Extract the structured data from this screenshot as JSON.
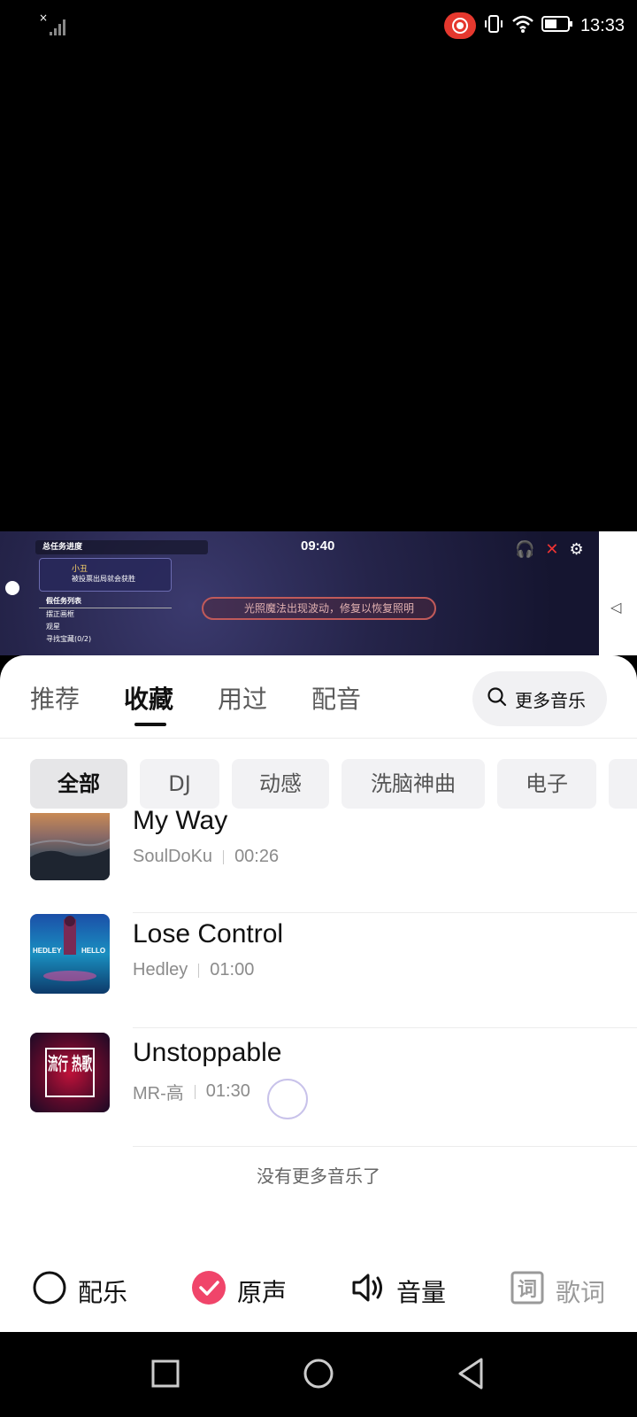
{
  "status_bar": {
    "time": "13:33"
  },
  "game": {
    "time": "09:40",
    "task_title": "总任务进度",
    "card_name": "小丑",
    "card_desc": "被投票出局就会获胜",
    "list_header": "假任务列表",
    "list_items": [
      "摆正画框",
      "观星",
      "寻找宝藏(0/2)"
    ],
    "banner": "光照魔法出现波动，修复以恢复照明"
  },
  "tabs": [
    {
      "label": "推荐"
    },
    {
      "label": "收藏"
    },
    {
      "label": "用过"
    },
    {
      "label": "配音"
    }
  ],
  "more_music": {
    "label": "更多音乐"
  },
  "chips": [
    {
      "label": "全部"
    },
    {
      "label": "DJ"
    },
    {
      "label": "动感"
    },
    {
      "label": "洗脑神曲"
    },
    {
      "label": "电子"
    }
  ],
  "songs": [
    {
      "title": "My Way",
      "artist": "SoulDoKu",
      "duration": "00:26"
    },
    {
      "title": "Lose Control",
      "artist": "Hedley",
      "duration": "01:00",
      "cover_text_left": "HEDLEY",
      "cover_text_right": "HELLO"
    },
    {
      "title": "Unstoppable",
      "artist": "MR-高",
      "duration": "01:30",
      "cover_text": "流行 热歌"
    }
  ],
  "no_more": "没有更多音乐了",
  "controls": {
    "music": "配乐",
    "original": "原声",
    "volume": "音量",
    "lyrics": "歌词",
    "lyrics_icon": "词"
  },
  "colors": {
    "accent_pink": "#f0456a",
    "record_red": "#e5382e"
  }
}
